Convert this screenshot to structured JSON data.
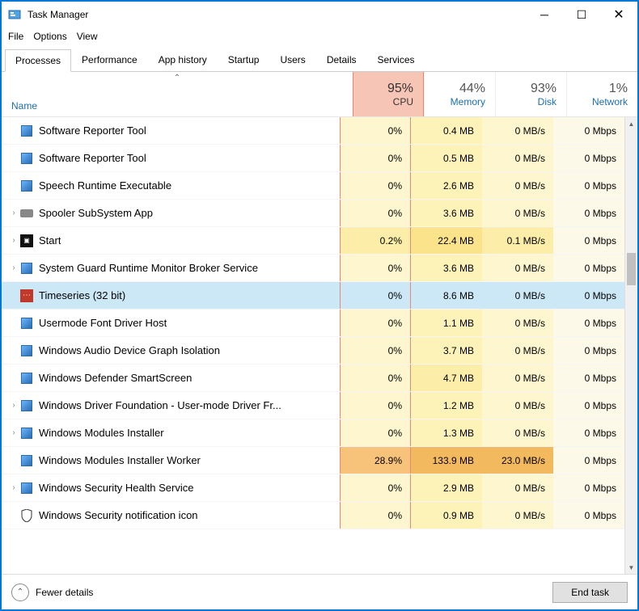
{
  "window": {
    "title": "Task Manager"
  },
  "menu": {
    "file": "File",
    "options": "Options",
    "view": "View"
  },
  "tabs": [
    "Processes",
    "Performance",
    "App history",
    "Startup",
    "Users",
    "Details",
    "Services"
  ],
  "headers": {
    "name": "Name",
    "cols": [
      {
        "pct": "95%",
        "label": "CPU"
      },
      {
        "pct": "44%",
        "label": "Memory"
      },
      {
        "pct": "93%",
        "label": "Disk"
      },
      {
        "pct": "1%",
        "label": "Network"
      }
    ]
  },
  "processes": [
    {
      "name": "Software Reporter Tool",
      "cpu": "0%",
      "mem": "0.4 MB",
      "disk": "0 MB/s",
      "net": "0 Mbps",
      "icon": "default"
    },
    {
      "name": "Software Reporter Tool",
      "cpu": "0%",
      "mem": "0.5 MB",
      "disk": "0 MB/s",
      "net": "0 Mbps",
      "icon": "default"
    },
    {
      "name": "Speech Runtime Executable",
      "cpu": "0%",
      "mem": "2.6 MB",
      "disk": "0 MB/s",
      "net": "0 Mbps",
      "icon": "default"
    },
    {
      "name": "Spooler SubSystem App",
      "cpu": "0%",
      "mem": "3.6 MB",
      "disk": "0 MB/s",
      "net": "0 Mbps",
      "expand": true,
      "icon": "printer"
    },
    {
      "name": "Start",
      "cpu": "0.2%",
      "mem": "22.4 MB",
      "disk": "0.1 MB/s",
      "net": "0 Mbps",
      "expand": true,
      "icon": "black",
      "memClass": "m2",
      "cpuClass": "c1",
      "diskClass": "d1"
    },
    {
      "name": "System Guard Runtime Monitor Broker Service",
      "cpu": "0%",
      "mem": "3.6 MB",
      "disk": "0 MB/s",
      "net": "0 Mbps",
      "expand": true,
      "icon": "default"
    },
    {
      "name": "Timeseries (32 bit)",
      "cpu": "0%",
      "mem": "8.6 MB",
      "disk": "0 MB/s",
      "net": "0 Mbps",
      "icon": "red",
      "selected": true
    },
    {
      "name": "Usermode Font Driver Host",
      "cpu": "0%",
      "mem": "1.1 MB",
      "disk": "0 MB/s",
      "net": "0 Mbps",
      "icon": "default"
    },
    {
      "name": "Windows Audio Device Graph Isolation",
      "cpu": "0%",
      "mem": "3.7 MB",
      "disk": "0 MB/s",
      "net": "0 Mbps",
      "icon": "default"
    },
    {
      "name": "Windows Defender SmartScreen",
      "cpu": "0%",
      "mem": "4.7 MB",
      "disk": "0 MB/s",
      "net": "0 Mbps",
      "icon": "default",
      "memClass": "m1"
    },
    {
      "name": "Windows Driver Foundation - User-mode Driver Fr...",
      "cpu": "0%",
      "mem": "1.2 MB",
      "disk": "0 MB/s",
      "net": "0 Mbps",
      "expand": true,
      "icon": "default"
    },
    {
      "name": "Windows Modules Installer",
      "cpu": "0%",
      "mem": "1.3 MB",
      "disk": "0 MB/s",
      "net": "0 Mbps",
      "expand": true,
      "icon": "default"
    },
    {
      "name": "Windows Modules Installer Worker",
      "cpu": "28.9%",
      "mem": "133.9 MB",
      "disk": "23.0 MB/s",
      "net": "0 Mbps",
      "icon": "default",
      "heavy": true
    },
    {
      "name": "Windows Security Health Service",
      "cpu": "0%",
      "mem": "2.9 MB",
      "disk": "0 MB/s",
      "net": "0 Mbps",
      "expand": true,
      "icon": "default"
    },
    {
      "name": "Windows Security notification icon",
      "cpu": "0%",
      "mem": "0.9 MB",
      "disk": "0 MB/s",
      "net": "0 Mbps",
      "icon": "shield"
    }
  ],
  "footer": {
    "fewer": "Fewer details",
    "endtask": "End task"
  }
}
